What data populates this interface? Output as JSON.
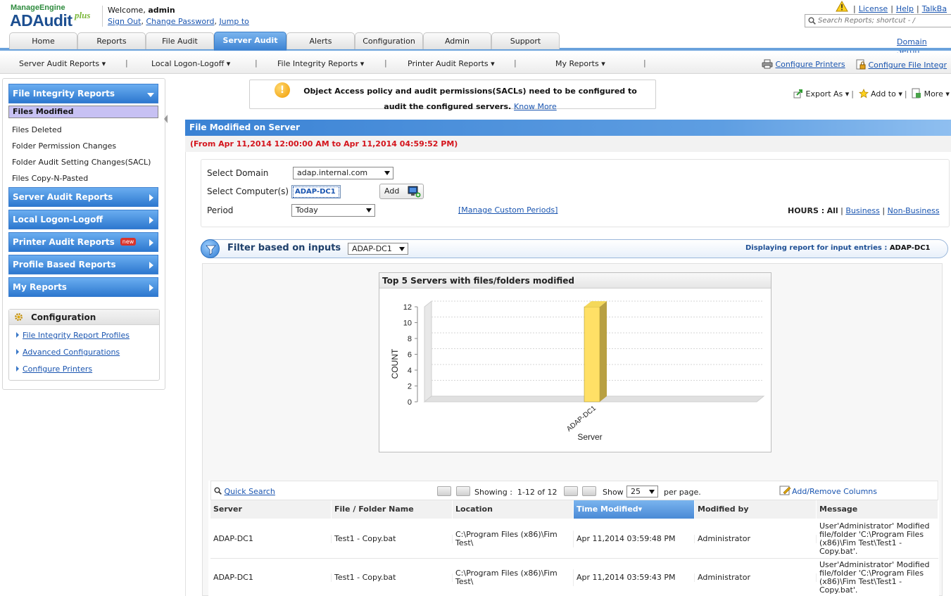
{
  "header": {
    "logo_top": "ManageEngine",
    "logo_main": "ADAudit",
    "logo_plus": "plus",
    "welcome_prefix": "Welcome,",
    "user": "admin",
    "links": [
      "Sign Out",
      "Change Password",
      "Jump to"
    ],
    "top_links": [
      "License",
      "Help",
      "TalkBa"
    ],
    "search_placeholder": "Search Reports; shortcut - /",
    "domain_settings": "Domain Settin"
  },
  "tabs": [
    "Home",
    "Reports",
    "File Audit",
    "Server Audit",
    "Alerts",
    "Configuration",
    "Admin",
    "Support"
  ],
  "active_tab": "Server Audit",
  "subnav": {
    "items": [
      "Server Audit Reports ▾",
      "Local Logon-Logoff ▾",
      "File Integrity Reports ▾",
      "Printer Audit Reports ▾",
      "My Reports ▾"
    ],
    "configure_printers": "Configure Printers",
    "configure_file": "Configure File Integr"
  },
  "sidebar": {
    "file_integrity_head": "File Integrity Reports",
    "file_integrity_items": [
      "Files Modified",
      "Files Deleted",
      "Folder Permission Changes",
      "Folder Audit Setting Changes(SACL)",
      "Files Copy-N-Pasted"
    ],
    "selected": "Files Modified",
    "sections": [
      "Server Audit Reports",
      "Local Logon-Logoff",
      "Printer Audit Reports",
      "Profile Based Reports",
      "My Reports"
    ],
    "new_badge": "new",
    "config_title": "Configuration",
    "config_links": [
      "File Integrity Report Profiles",
      "Advanced Configurations",
      "Configure Printers"
    ]
  },
  "notice": {
    "text": "Object Access policy and audit permissions(SACLs) need to be configured to audit the configured servers.",
    "link": "Know More"
  },
  "actions": {
    "export": "Export As ▾",
    "add_to": "Add to ▾",
    "more": "More ▾"
  },
  "report": {
    "title": "File Modified on Server",
    "date_range": "(From Apr 11,2014 12:00:00 AM to Apr 11,2014 04:59:52 PM)",
    "domain_label": "Select Domain",
    "domain_value": "adap.internal.com",
    "computer_label": "Select Computer(s)",
    "computer_value": "ADAP-DC1",
    "add_button": "Add",
    "period_label": "Period",
    "period_value": "Today",
    "manage_periods": "[Manage Custom Periods]",
    "hours_label": "HOURS :",
    "hours_all": "All",
    "hours_business": "Business",
    "hours_nonbusiness": "Non-Business",
    "filter_title": "Filter based on inputs",
    "filter_value": "ADAP-DC1",
    "display_label": "Displaying report for input entries :",
    "display_value": "ADAP-DC1"
  },
  "chart_data": {
    "type": "bar",
    "title": "Top 5 Servers with files/folders modified",
    "categories": [
      "ADAP-DC1"
    ],
    "values": [
      12
    ],
    "xlabel": "Server",
    "ylabel": "COUNT",
    "ylim": [
      0,
      12
    ],
    "yticks": [
      0,
      2,
      4,
      6,
      8,
      10,
      12
    ],
    "grid": true,
    "bar_color": "#ffe066"
  },
  "table": {
    "quick_search": "Quick Search",
    "showing_label": "Showing :",
    "showing_value": "1-12 of 12",
    "show_label": "Show",
    "per_page": "25",
    "per_page_suffix": "per page.",
    "add_remove": "Add/Remove Columns",
    "columns": [
      "Server",
      "File / Folder Name",
      "Location",
      "Time Modified▾",
      "Modified by",
      "Message"
    ],
    "sorted_column": "Time Modified▾",
    "rows": [
      [
        "ADAP-DC1",
        "Test1 - Copy.bat",
        "C:\\Program Files (x86)\\Fim Test\\",
        "Apr 11,2014 03:59:48 PM",
        "Administrator",
        "User'Administrator' Modified file/folder 'C:\\Program Files (x86)\\Fim Test\\Test1 - Copy.bat'."
      ],
      [
        "ADAP-DC1",
        "Test1 - Copy.bat",
        "C:\\Program Files (x86)\\Fim Test\\",
        "Apr 11,2014 03:59:43 PM",
        "Administrator",
        "User'Administrator' Modified file/folder 'C:\\Program Files (x86)\\Fim Test\\Test1 - Copy.bat'."
      ]
    ]
  }
}
